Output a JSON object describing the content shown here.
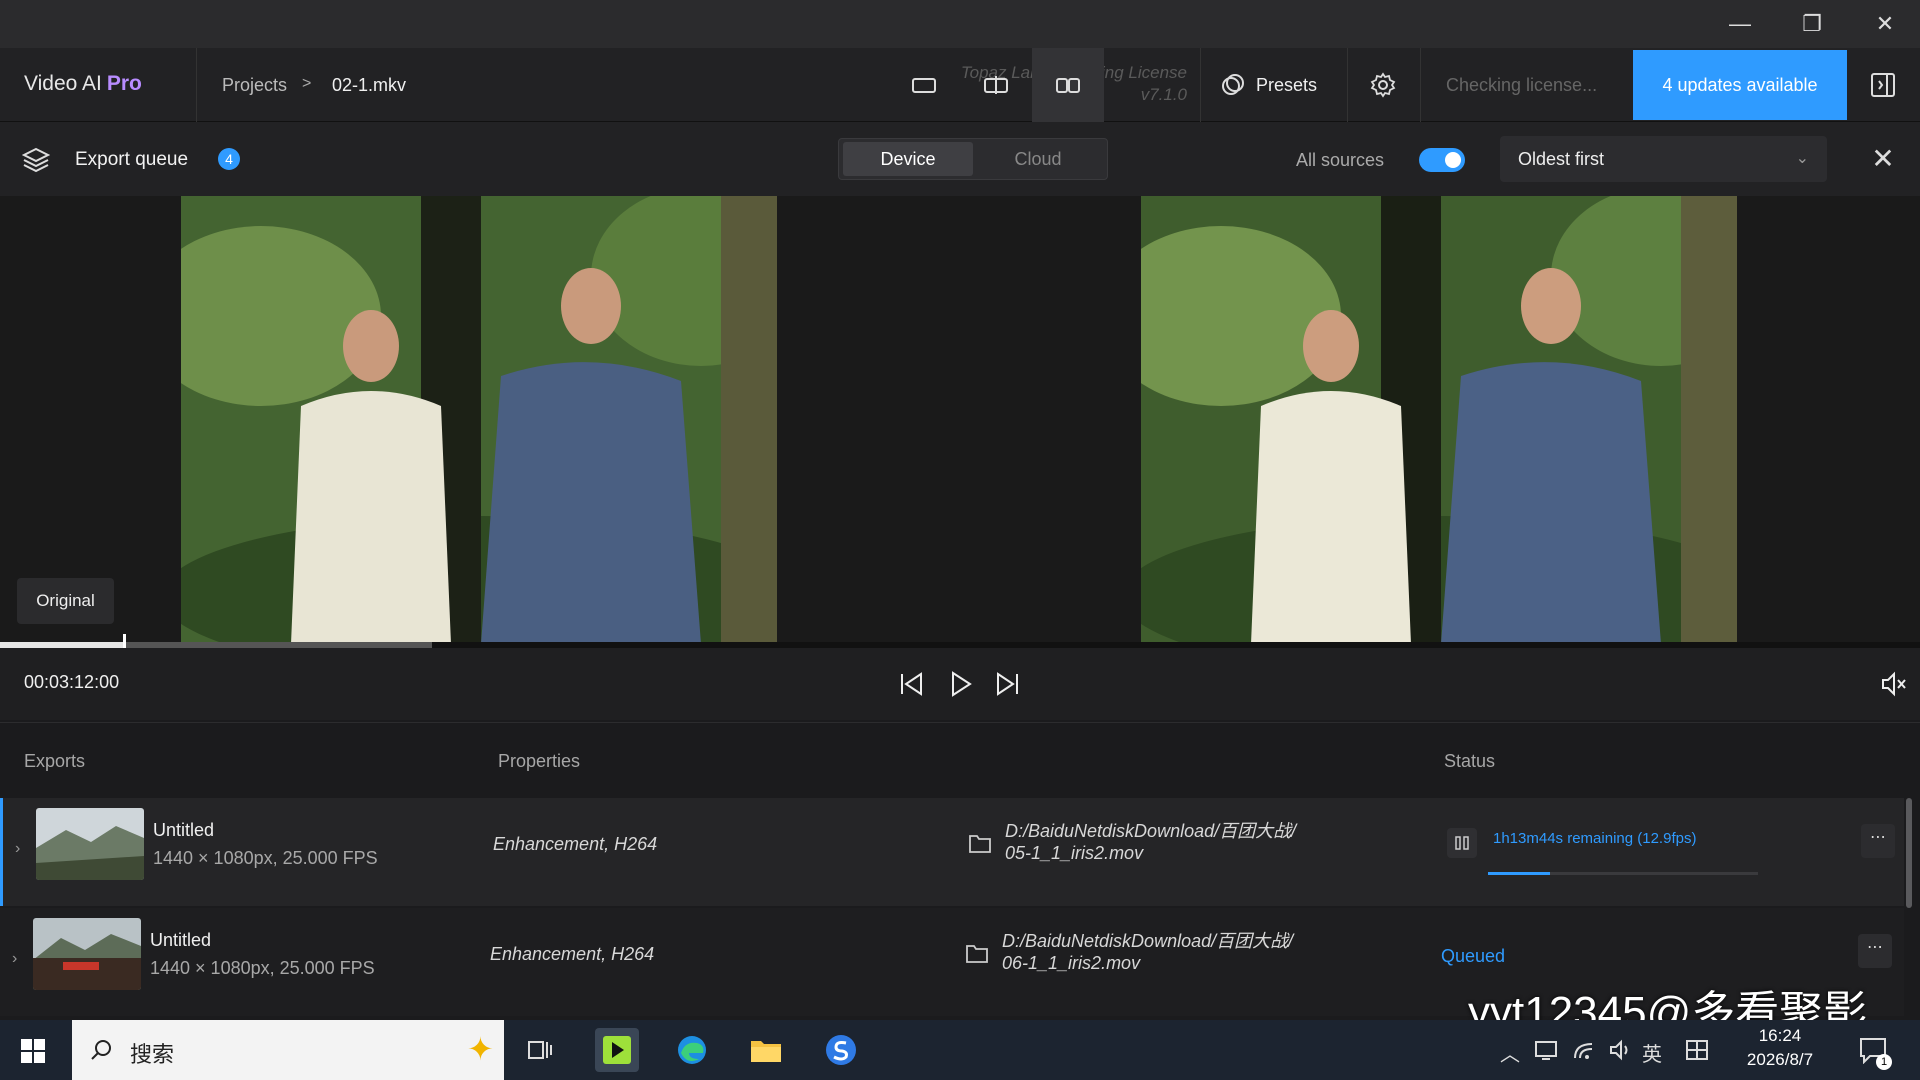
{
  "window": {
    "minimize": "—",
    "restore": "❐",
    "close": "✕"
  },
  "app": {
    "name": "Video AI",
    "edition": "Pro"
  },
  "breadcrumb": {
    "projects": "Projects",
    "separator": ">",
    "file": "02-1.mkv"
  },
  "license": {
    "line1": "Topaz Labs - Floating License",
    "line2": "v7.1.0"
  },
  "header": {
    "presets_label": "Presets",
    "checking_label": "Checking license...",
    "updates_label": "4 updates available"
  },
  "queue": {
    "title": "Export queue",
    "count": "4",
    "tabs": {
      "device": "Device",
      "cloud": "Cloud"
    },
    "all_sources_label": "All sources",
    "all_sources_on": true,
    "sort": "Oldest first"
  },
  "preview": {
    "original_label": "Original"
  },
  "playback": {
    "timecode": "00:03:12:00",
    "played_fraction": 0.065,
    "buffered_fraction": 0.225
  },
  "table": {
    "headers": {
      "exports": "Exports",
      "properties": "Properties",
      "status": "Status"
    },
    "rows": [
      {
        "name": "Untitled",
        "meta": "1440 × 1080px, 25.000 FPS",
        "props": "Enhancement, H264",
        "path_line1": "D:/BaiduNetdiskDownload/百团大战/",
        "path_line2": "05-1_1_iris2.mov",
        "status": "1h13m44s remaining (12.9fps)",
        "progress": 0.23
      },
      {
        "name": "Untitled",
        "meta": "1440 × 1080px, 25.000 FPS",
        "props": "Enhancement, H264",
        "path_line1": "D:/BaiduNetdiskDownload/百团大战/",
        "path_line2": "06-1_1_iris2.mov",
        "status": "Queued"
      }
    ]
  },
  "overlay": {
    "text": "yyt12345@多看聚影"
  },
  "taskbar": {
    "search_label": "搜索",
    "ime": "英",
    "time": "16:24",
    "date": "2026/8/7",
    "notifications": "1"
  },
  "colors": {
    "accent": "#2f9bff",
    "pro": "#b88cff"
  }
}
